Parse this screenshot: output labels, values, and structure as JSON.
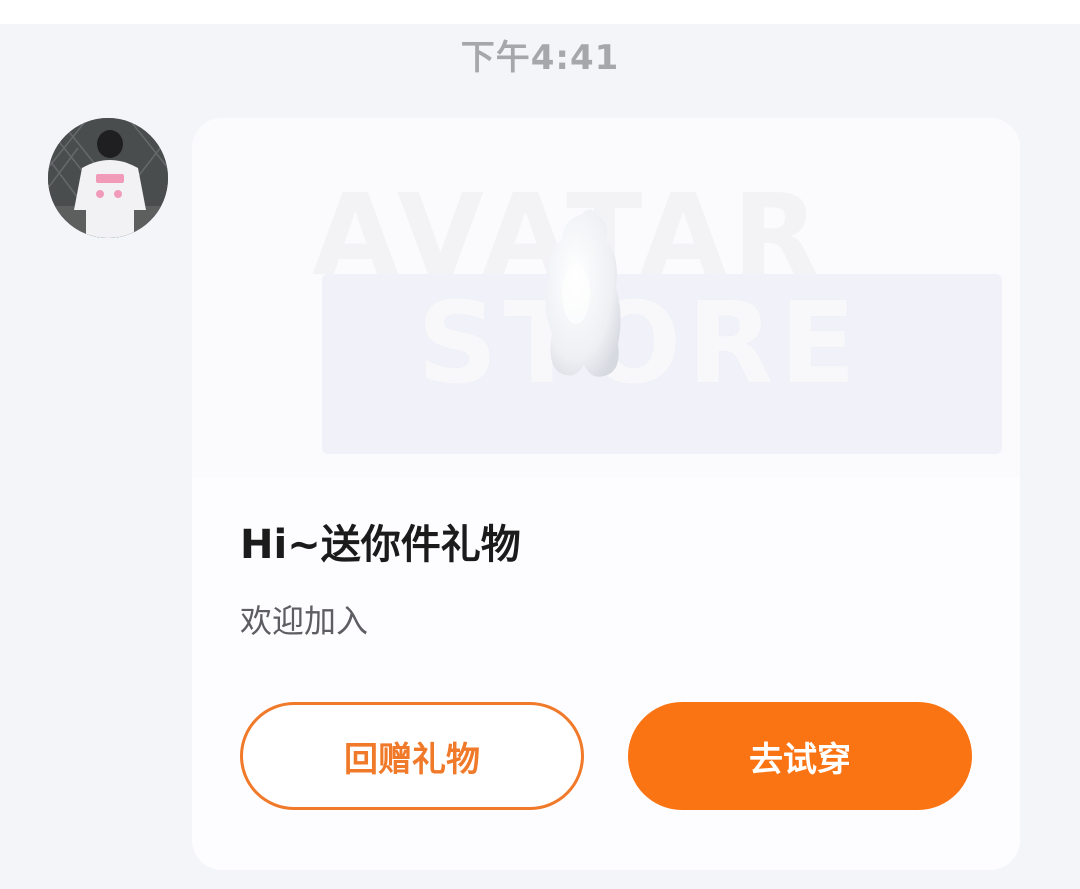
{
  "timestamp": "下午4:41",
  "avatar": {
    "icon": "user-avatar-photo"
  },
  "card": {
    "banner": {
      "line1": "AVATAR",
      "line2": "STORE",
      "mascot_icon": "gift-mascot-icon"
    },
    "title": "Hi~送你件礼物",
    "subtitle": "欢迎加入",
    "buttons": {
      "return_gift": "回赠礼物",
      "try_on": "去试穿"
    }
  },
  "colors": {
    "accent": "#fb7414",
    "outline": "#f07a2a",
    "page_bg": "#f4f5f8",
    "card_bg": "#fdfdff"
  }
}
